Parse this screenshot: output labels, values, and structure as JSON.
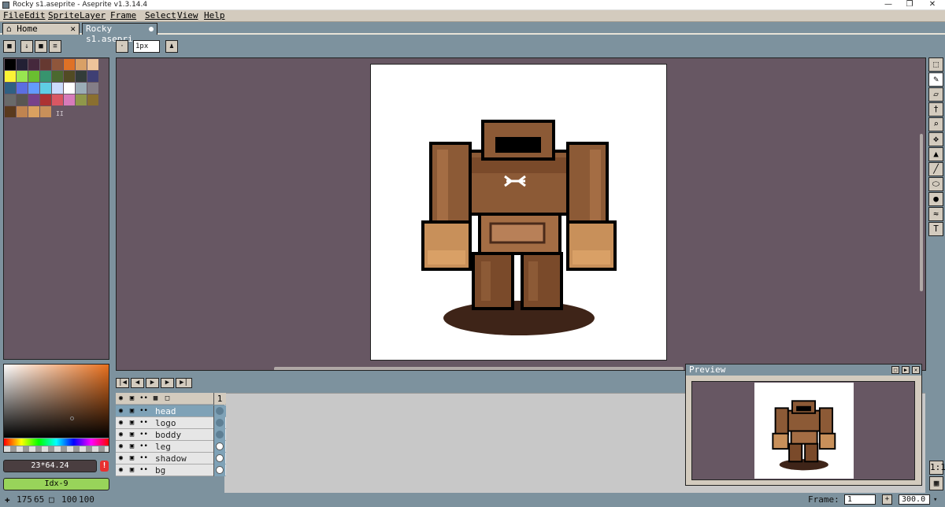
{
  "window": {
    "title": "Rocky s1.aseprite - Aseprite v1.3.14.4",
    "minimize": "—",
    "maximize": "❐",
    "close": "✕"
  },
  "menu": [
    "File",
    "Edit",
    "Sprite",
    "Layer",
    "Frame",
    "Select",
    "View",
    "Help"
  ],
  "tabs": {
    "home_label": "Home",
    "home_close": "✕",
    "doc_label": "Rocky s1.asepri"
  },
  "toolbar": {
    "pixel_size_value": "1px"
  },
  "palette": {
    "page_indicator": "II",
    "colors": [
      "#000000",
      "#222034",
      "#45283c",
      "#663931",
      "#8f563b",
      "#df7126",
      "#d9a066",
      "#eec39a",
      "#fbf236",
      "#99e550",
      "#6abe30",
      "#37946e",
      "#4b692f",
      "#524b24",
      "#323c39",
      "#3f3f74",
      "#306082",
      "#5b6ee1",
      "#639bff",
      "#5fcde4",
      "#cbdbfc",
      "#ffffff",
      "#9badb7",
      "#847e87",
      "#696a6a",
      "#595652",
      "#76428a",
      "#ac3232",
      "#d95763",
      "#d77bba",
      "#8f974a",
      "#8a6f30",
      "#5a3a1e",
      "#c08450",
      "#d9a060",
      "#c8905a"
    ]
  },
  "color": {
    "hex_text": "23*64.24",
    "warning_mark": "!",
    "index_text": "Idx-9",
    "accent": "#e8701e"
  },
  "timeline": {
    "frame_header": "1",
    "layers": [
      {
        "name": "head",
        "selected": true,
        "cel": "empty"
      },
      {
        "name": "logo",
        "selected": false,
        "cel": "empty"
      },
      {
        "name": "boddy",
        "selected": false,
        "cel": "empty"
      },
      {
        "name": "leg",
        "selected": false,
        "cel": "filled"
      },
      {
        "name": "shadow",
        "selected": false,
        "cel": "filled"
      },
      {
        "name": "bg",
        "selected": false,
        "cel": "filled"
      }
    ]
  },
  "preview": {
    "title": "Preview"
  },
  "tools": [
    "rectangular-marquee",
    "pencil",
    "eraser",
    "eyedropper",
    "zoom",
    "move",
    "paint-bucket",
    "line",
    "ellipse",
    "contour",
    "blur",
    "text"
  ],
  "tool_glyphs": {
    "rectangular-marquee": "⬚",
    "pencil": "✎",
    "eraser": "▱",
    "eyedropper": "†",
    "zoom": "⌕",
    "move": "✥",
    "paint-bucket": "▲",
    "line": "╱",
    "ellipse": "⬭",
    "contour": "●",
    "blur": "≈",
    "text": "T"
  },
  "status": {
    "cursor_x": "175",
    "cursor_y": "65",
    "sprite_w": "100",
    "sprite_h": "100",
    "frame_label": "Frame:",
    "frame_value": "1",
    "zoom_value": "300.0",
    "one_to_one": "1:1"
  }
}
